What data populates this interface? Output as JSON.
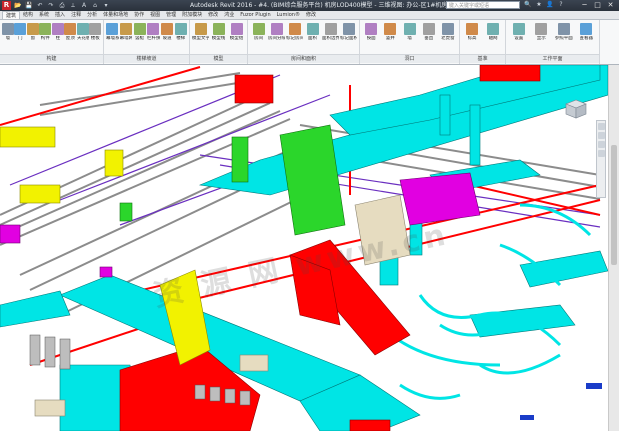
{
  "window": {
    "title": "Autodesk Revit 2016 -   #4. (BIM综合服务平台) 机房LOD400模型 - 三维视图: 办公-区1#机房",
    "search_placeholder": "键入关键字或短语",
    "app_logo": "R",
    "controls": [
      "─",
      "□",
      "✕"
    ]
  },
  "quick_access": [
    "📂",
    "💾",
    "↶",
    "↷",
    "⎙",
    "⟂",
    "A",
    "⌂",
    "▾"
  ],
  "title_icons": [
    "🔍",
    "★",
    "👤",
    "?"
  ],
  "tabs": [
    "建筑",
    "结构",
    "系统",
    "插入",
    "注释",
    "分析",
    "体量和场地",
    "协作",
    "视图",
    "管理",
    "附加模块",
    "修改",
    "鸿业",
    "Fuzor Plugin",
    "Lumion®",
    "修改"
  ],
  "active_tab": 0,
  "ribbon_groups": [
    {
      "label": "构建",
      "buttons": [
        "墙",
        "门",
        "窗",
        "构件",
        "柱",
        "屋顶",
        "天花板",
        "楼板"
      ]
    },
    {
      "label": "楼梯坡道",
      "buttons": [
        "幕墙系统",
        "幕墙网格",
        "竖梃",
        "栏杆扶手",
        "坡道",
        "楼梯"
      ]
    },
    {
      "label": "模型",
      "buttons": [
        "模型文字",
        "模型线",
        "模型组"
      ]
    },
    {
      "label": "房间和面积",
      "buttons": [
        "房间",
        "房间分隔",
        "标记房间",
        "面积",
        "面积边界",
        "标记面积"
      ]
    },
    {
      "label": "洞口",
      "buttons": [
        "按面",
        "竖井",
        "墙",
        "垂直",
        "老虎窗"
      ]
    },
    {
      "label": "基准",
      "buttons": [
        "标高",
        "轴网"
      ]
    },
    {
      "label": "工作平面",
      "buttons": [
        "设置",
        "显示",
        "参照平面",
        "查看器"
      ]
    }
  ],
  "colors": {
    "ductwork": "#00e5e5",
    "fire_pipe": "#ff0000",
    "equipment_yellow": "#f2f200",
    "equipment_green": "#2bd62b",
    "equipment_magenta": "#e100e1",
    "pipe_gray": "#8c8c8c",
    "pipe_purple": "#6a2fc0",
    "equipment_beige": "#e6dcc0"
  },
  "watermark_text": "资 源 网 www.cn"
}
